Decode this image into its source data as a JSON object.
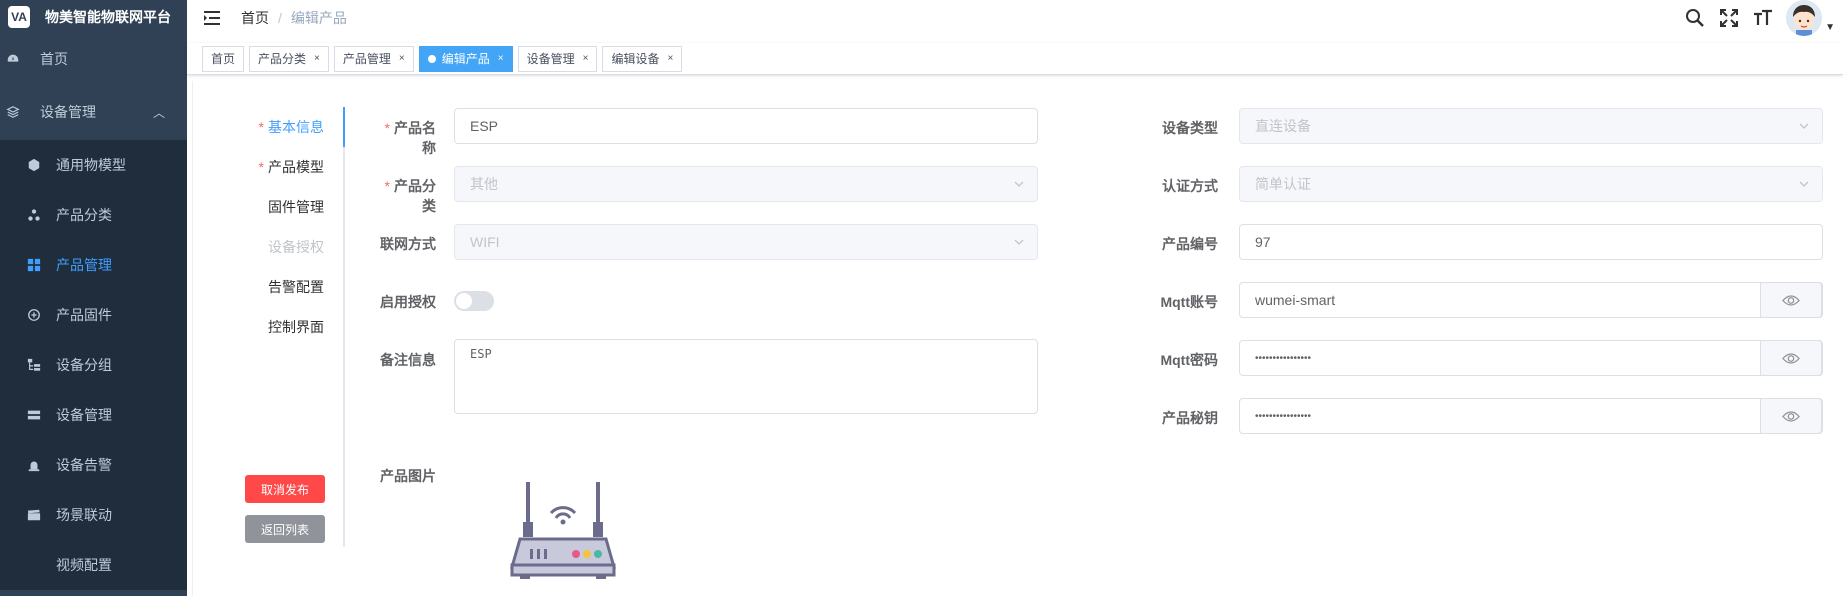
{
  "app": {
    "logo_mark": "VA",
    "title": "物美智能物联网平台"
  },
  "sidebar": {
    "home": "首页",
    "group": "设备管理",
    "items": [
      {
        "label": "通用物模型",
        "icon": "cube-icon"
      },
      {
        "label": "产品分类",
        "icon": "category-icon"
      },
      {
        "label": "产品管理",
        "icon": "grid-icon"
      },
      {
        "label": "产品固件",
        "icon": "firmware-icon"
      },
      {
        "label": "设备分组",
        "icon": "tree-icon"
      },
      {
        "label": "设备管理",
        "icon": "server-icon"
      },
      {
        "label": "设备告警",
        "icon": "alarm-icon"
      },
      {
        "label": "场景联动",
        "icon": "clapper-icon"
      },
      {
        "label": "视频配置",
        "icon": "video-icon"
      }
    ]
  },
  "header": {
    "breadcrumb": {
      "home": "首页",
      "sep": "/",
      "current": "编辑产品"
    }
  },
  "tags": [
    {
      "label": "首页",
      "closable": false,
      "active": false
    },
    {
      "label": "产品分类",
      "closable": true,
      "active": false
    },
    {
      "label": "产品管理",
      "closable": true,
      "active": false
    },
    {
      "label": "编辑产品",
      "closable": true,
      "active": true
    },
    {
      "label": "设备管理",
      "closable": true,
      "active": false
    },
    {
      "label": "编辑设备",
      "closable": true,
      "active": false
    }
  ],
  "tag_close": "×",
  "vtabs": [
    {
      "label": "基本信息",
      "required": true
    },
    {
      "label": "产品模型",
      "required": true
    },
    {
      "label": "固件管理",
      "required": false
    },
    {
      "label": "设备授权",
      "required": false
    },
    {
      "label": "告警配置",
      "required": false
    },
    {
      "label": "控制界面",
      "required": false
    }
  ],
  "required_mark": "*",
  "buttons": {
    "unpublish": "取消发布",
    "back": "返回列表"
  },
  "form": {
    "product_name": {
      "label": "产品名称",
      "value": "ESP"
    },
    "product_category": {
      "label": "产品分类",
      "value": "其他"
    },
    "network": {
      "label": "联网方式",
      "value": "WIFI"
    },
    "enable_auth": {
      "label": "启用授权",
      "on": false
    },
    "remark": {
      "label": "备注信息",
      "value": "ESP"
    },
    "product_image": {
      "label": "产品图片"
    },
    "device_type": {
      "label": "设备类型",
      "value": "直连设备"
    },
    "auth_method": {
      "label": "认证方式",
      "value": "简单认证"
    },
    "product_id": {
      "label": "产品编号",
      "value": "97"
    },
    "mqtt_account": {
      "label": "Mqtt账号",
      "value": "wumei-smart"
    },
    "mqtt_password": {
      "label": "Mqtt密码",
      "value": "••••••••••••••••"
    },
    "product_secret": {
      "label": "产品秘钥",
      "value": "••••••••••••••••"
    }
  },
  "colors": {
    "primary": "#409eff",
    "sidebar_bg": "#304156",
    "danger": "#ff4949"
  }
}
